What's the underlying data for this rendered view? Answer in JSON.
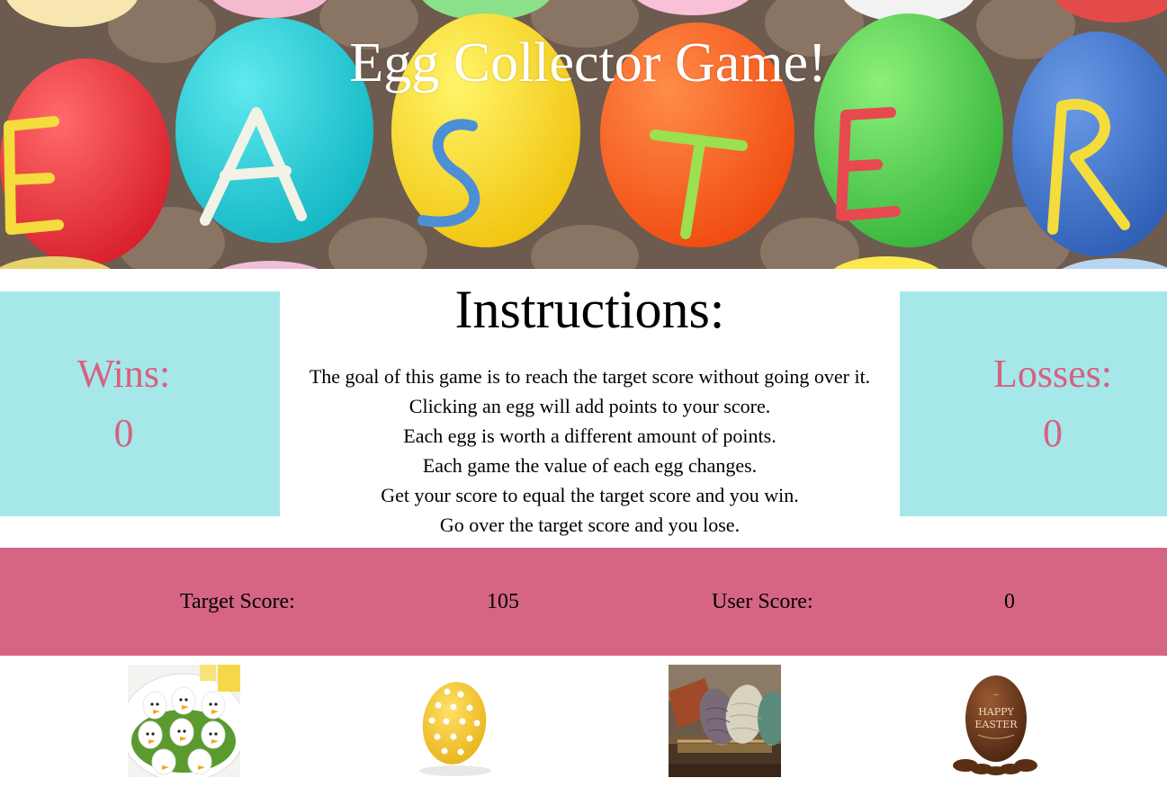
{
  "header": {
    "title": "Egg Collector Game!",
    "banner_letters": [
      "E",
      "A",
      "S",
      "T",
      "E",
      "R"
    ]
  },
  "wins": {
    "label": "Wins:",
    "value": "0"
  },
  "losses": {
    "label": "Losses:",
    "value": "0"
  },
  "instructions": {
    "title": "Instructions:",
    "lines": [
      "The goal of this game is to reach the target score without going over it.",
      "Clicking an egg will add points to your score.",
      "Each egg is worth a different amount of points.",
      "Each game the value of each egg changes.",
      "Get your score to equal the target score and you win.",
      "Go over the target score and you lose."
    ]
  },
  "scorebar": {
    "target_label": "Target Score:",
    "target_value": "105",
    "user_label": "User Score:",
    "user_value": "0"
  },
  "eggs": [
    {
      "name": "deviled-chick-eggs",
      "icon": "chick-eggs-image"
    },
    {
      "name": "yellow-polka-dot-egg",
      "icon": "polka-dot-egg-image"
    },
    {
      "name": "dragon-eggs-chest",
      "icon": "dragon-eggs-image"
    },
    {
      "name": "chocolate-happy-easter-egg",
      "icon": "chocolate-egg-image",
      "text": "HAPPY EASTER"
    }
  ],
  "colors": {
    "panel_bg": "#a6e8ea",
    "panel_text": "#d5627f",
    "scorebar_bg": "#d66584"
  }
}
